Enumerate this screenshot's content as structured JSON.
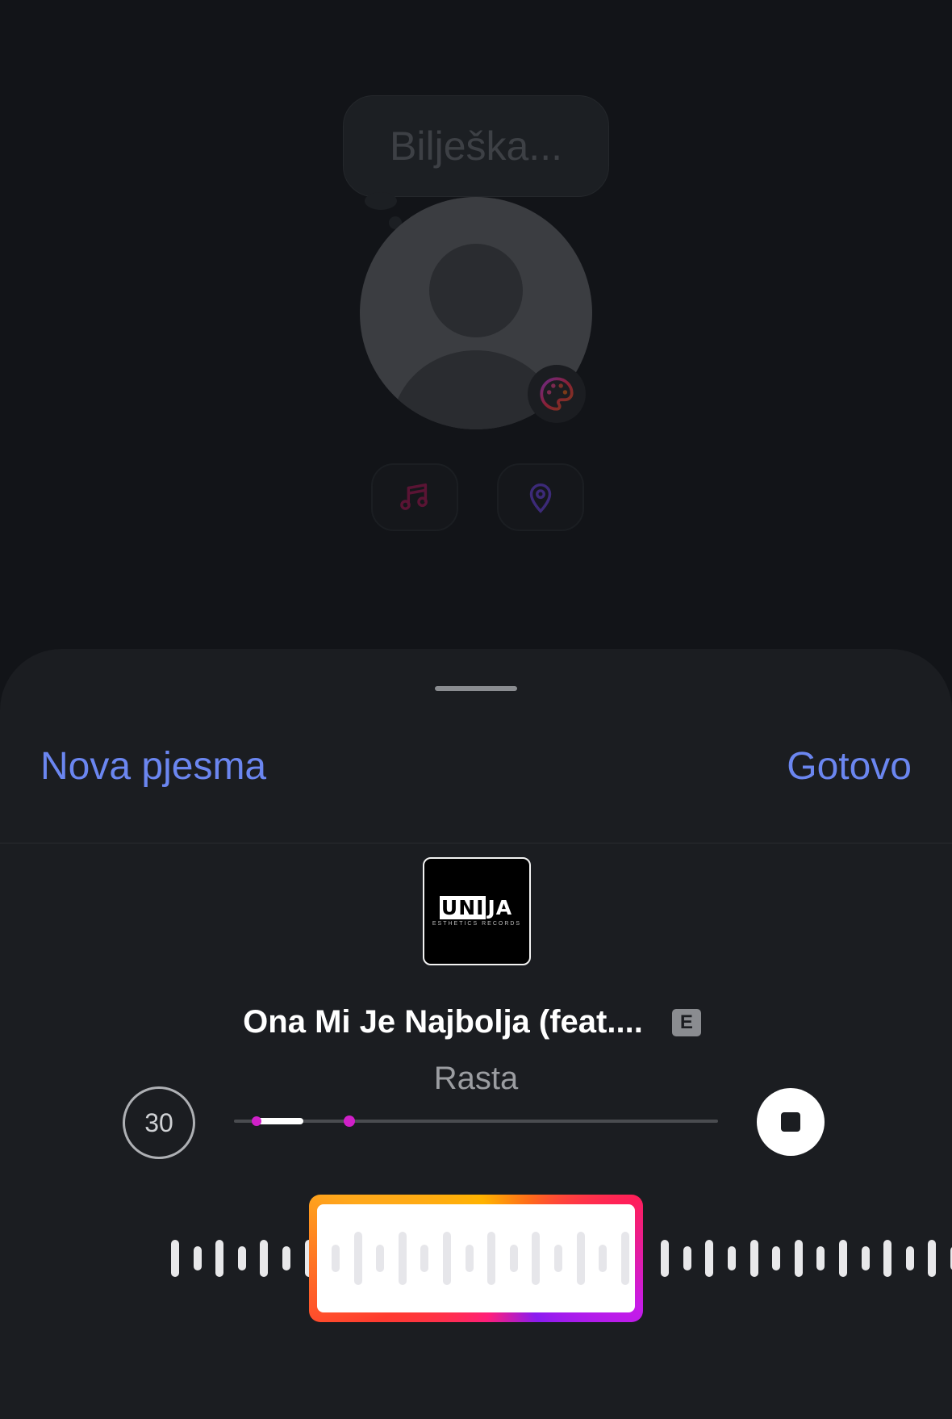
{
  "composer": {
    "note_placeholder": "Bilješka...",
    "icons": [
      "palette-icon",
      "music-note-icon",
      "location-pin-icon"
    ]
  },
  "sheet": {
    "header": {
      "left_label": "Nova pjesma",
      "right_label": "Gotovo"
    },
    "track": {
      "cover_text_part1": "UNI",
      "cover_text_part2": "JA",
      "cover_subtext": "ESTHETICS RECORDS",
      "title": "Ona Mi Je Najbolja (feat....",
      "explicit_badge": "E",
      "artist": "Rasta"
    },
    "player": {
      "duration_label": "30",
      "progress_fraction": 0.14,
      "stop_icon": "stop-icon"
    }
  },
  "colors": {
    "accent_blue": "#6b86f0",
    "progress_pink": "#d020c8",
    "sheet_bg": "#1b1d21",
    "page_bg": "#121418"
  }
}
